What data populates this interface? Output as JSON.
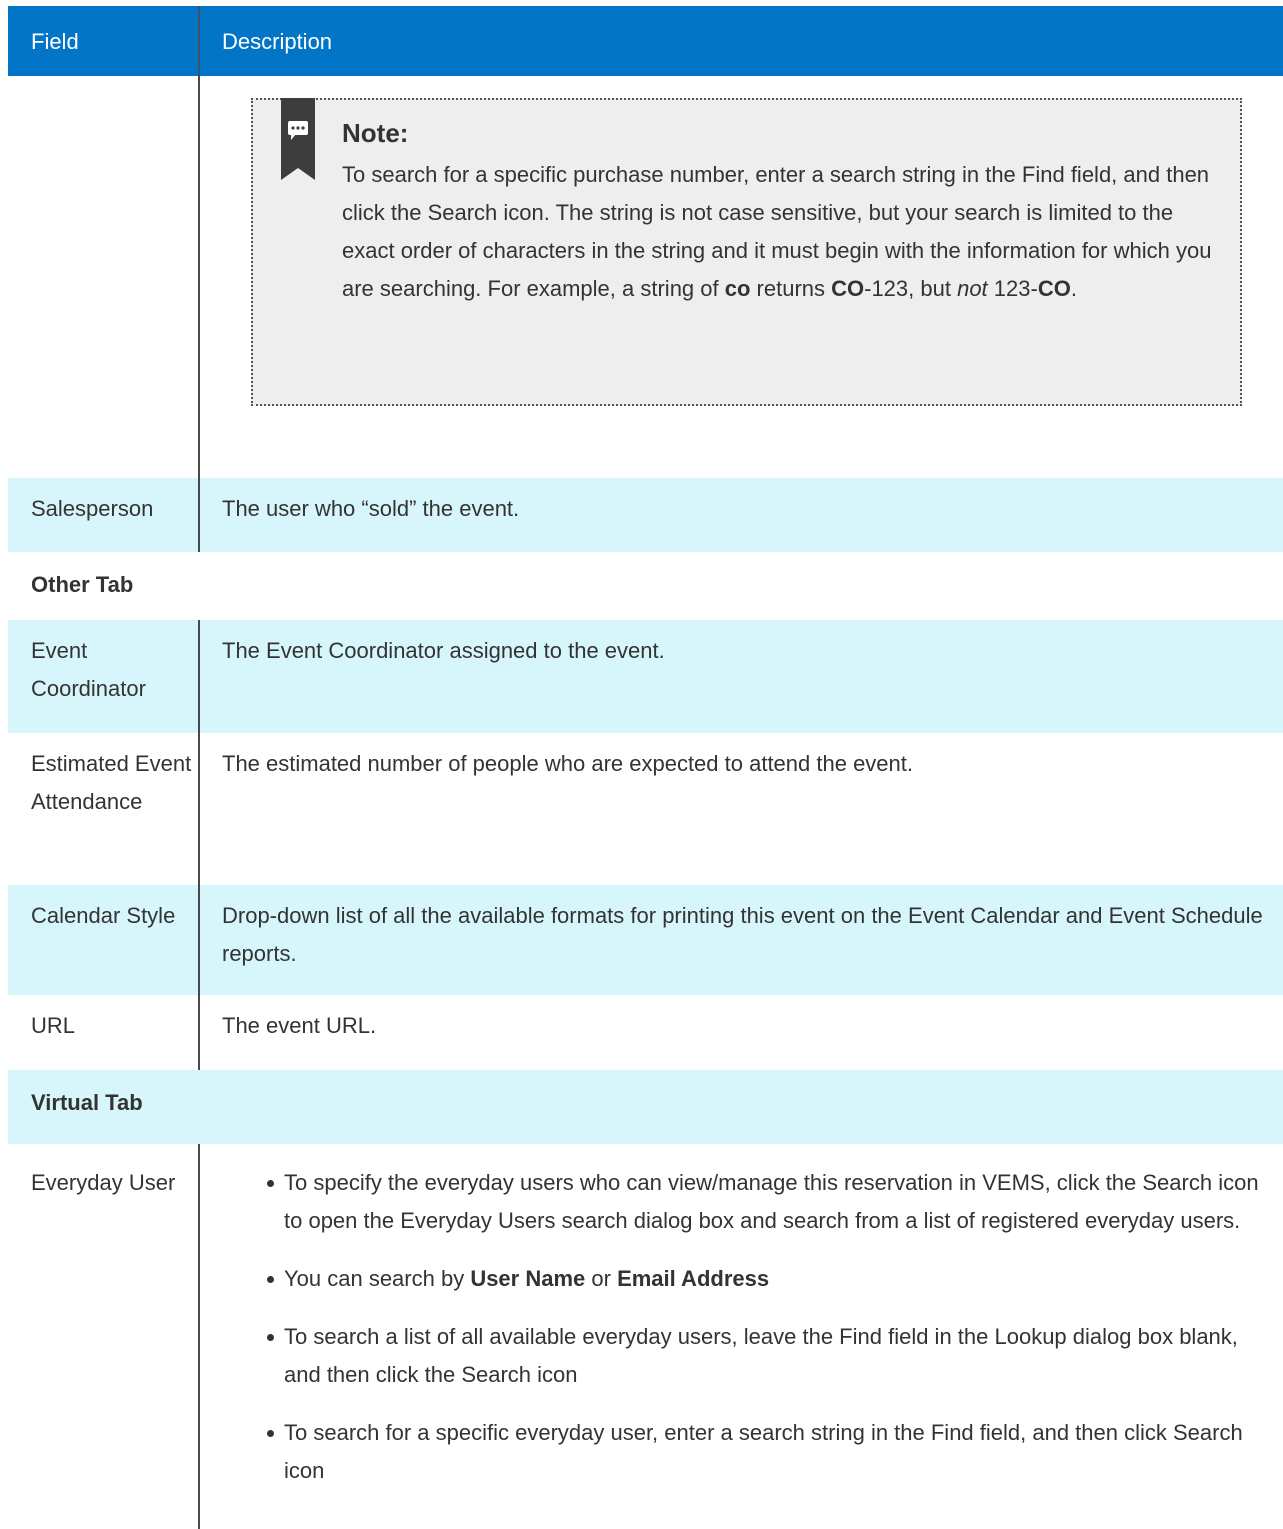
{
  "header": {
    "field_label": "Field",
    "description_label": "Description"
  },
  "note": {
    "icon": "chat-bubble-icon",
    "title": "Note:",
    "text_parts": [
      "To search for a specific purchase number, enter a search string in the Find field, and then click the Search icon. The string is not case sensitive, but your search is limited to the exact order of characters in the string and it must begin with the information for which you are searching. For example, a string of ",
      "co",
      " returns ",
      "CO",
      "-123, but ",
      "not",
      " 123-",
      "CO",
      "."
    ]
  },
  "rows": {
    "salesperson": {
      "field": "Salesperson",
      "description": "The user who “sold” the event."
    },
    "other_tab": "Other Tab",
    "event_coordinator": {
      "field": "Event Coordinator",
      "description": "The Event Coordinator assigned to the event."
    },
    "estimated_attendance": {
      "field": "Estimated Event Attendance",
      "description": "The estimated number of people who are expected to attend the event."
    },
    "calendar_style": {
      "field": "Calendar Style",
      "description": "Drop-down list of all the available formats for printing this event on the Event Calendar and Event Schedule reports."
    },
    "url": {
      "field": "URL",
      "description": "The event URL."
    },
    "virtual_tab": "Virtual Tab",
    "everyday_user": {
      "field": "Everyday User",
      "bullet1": "To specify the everyday users who can view/manage this reservation in VEMS, click the Search icon to open the Everyday Users search dialog box and search from a list of registered everyday users.",
      "bullet2_pre": "You can search by ",
      "bullet2_b1": "User Name",
      "bullet2_mid": " or ",
      "bullet2_b2": "Email Address",
      "bullet3": "To search a list of all available everyday users, leave the Find field in the Lookup dialog box blank, and then click the Search icon",
      "bullet4": "To search for a specific everyday user, enter a search string in the Find field, and then click Search icon"
    }
  },
  "colors": {
    "header_bg": "#0275c7",
    "shaded_row_bg": "#d7f6fc",
    "note_bg": "#eeeeee"
  }
}
